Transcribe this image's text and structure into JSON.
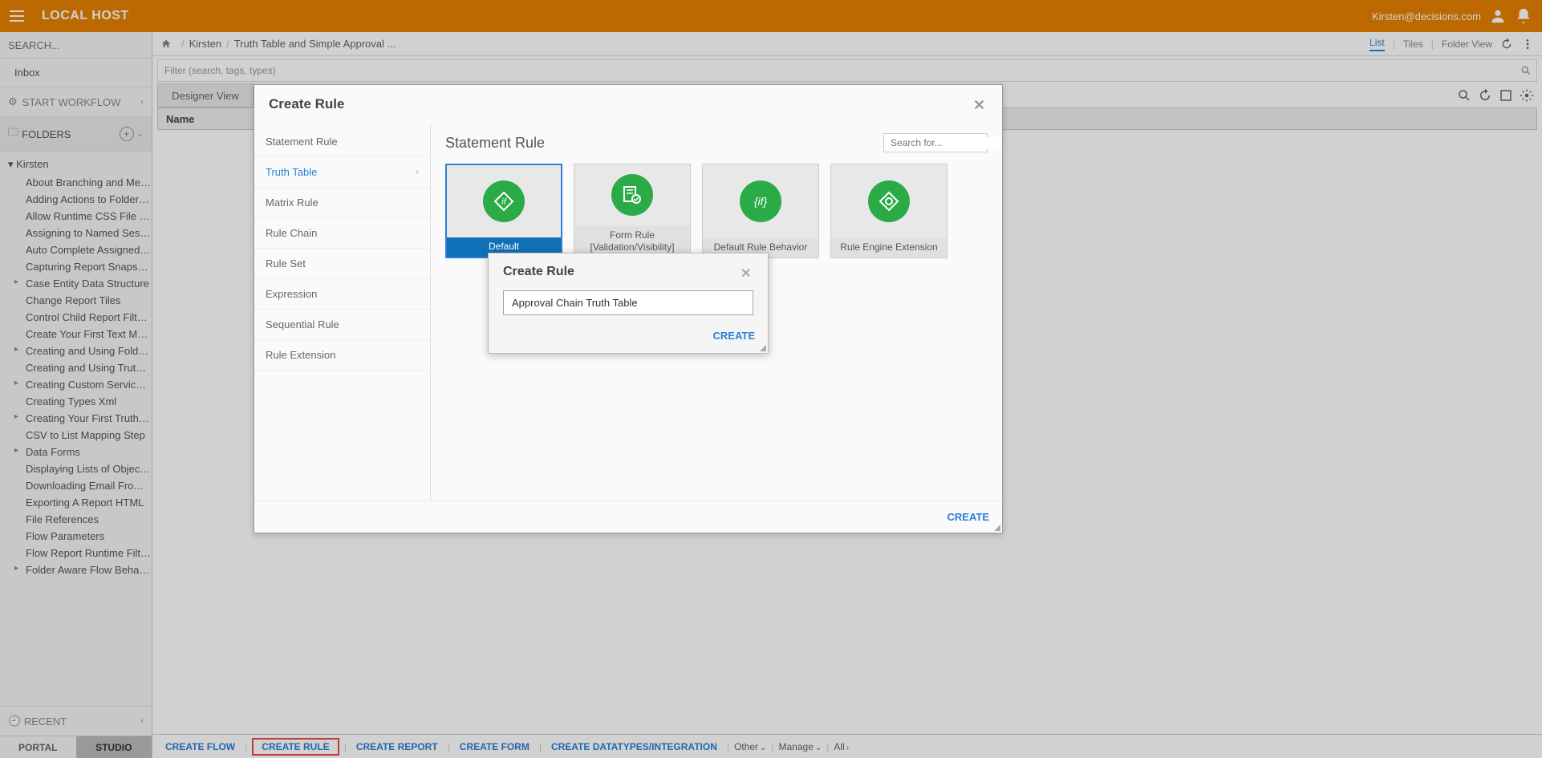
{
  "header": {
    "title": "LOCAL HOST",
    "user_email": "Kirsten@decisions.com"
  },
  "sidebar": {
    "search_placeholder": "SEARCH...",
    "inbox": "Inbox",
    "start_workflow": "START WORKFLOW",
    "folders_label": "FOLDERS",
    "root": "Kirsten",
    "items": [
      "About Branching and Merging Flows",
      "Adding Actions to Folder Extensions",
      "Allow Runtime CSS File Name",
      "Assigning to Named Sessions",
      "Auto Complete Assigned Form",
      "Capturing Report Snapshot",
      "Case Entity Data Structure",
      "Change Report Tiles",
      "Control Child Report Filter Value",
      "Create Your First Text Merge",
      "Creating and Using Folder Extensions",
      "Creating and Using Truth Tables",
      "Creating Custom Service Catalog",
      "Creating Types Xml",
      "Creating Your First Truth Table",
      "CSV to List Mapping Step",
      "Data Forms",
      "Displaying Lists of Objects In A Form",
      "Downloading Email From a Mail",
      "Exporting A Report HTML",
      "File References",
      "Flow Parameters",
      "Flow Report Runtime Filters",
      "Folder Aware Flow Behavior"
    ],
    "arrow_indices": [
      6,
      10,
      12,
      14,
      16,
      23
    ],
    "recent": "RECENT",
    "tabs": {
      "portal": "PORTAL",
      "studio": "STUDIO"
    }
  },
  "breadcrumb": {
    "items": [
      "Kirsten",
      "Truth Table and Simple Approval ..."
    ],
    "views": {
      "list": "List",
      "tiles": "Tiles",
      "folder": "Folder View"
    }
  },
  "filter_placeholder": "Filter (search, tags, types)",
  "designer_view": "Designer View",
  "name_col": "Name",
  "bottom": {
    "create_flow": "CREATE FLOW",
    "create_rule": "CREATE RULE",
    "create_report": "CREATE REPORT",
    "create_form": "CREATE FORM",
    "create_dt": "CREATE DATATYPES/INTEGRATION",
    "other": "Other",
    "manage": "Manage",
    "all": "All"
  },
  "modal": {
    "title": "Create Rule",
    "categories": [
      "Statement Rule",
      "Truth Table",
      "Matrix Rule",
      "Rule Chain",
      "Rule Set",
      "Expression",
      "Sequential Rule",
      "Rule Extension"
    ],
    "active_category_index": 1,
    "main_title": "Statement Rule",
    "search_placeholder": "Search for...",
    "cards": [
      {
        "label": "Default"
      },
      {
        "label": "Form Rule [Validation/Visibility]"
      },
      {
        "label": "Default Rule Behavior"
      },
      {
        "label": "Rule Engine Extension"
      }
    ],
    "create": "CREATE"
  },
  "small_modal": {
    "title": "Create Rule",
    "value": "Approval Chain Truth Table",
    "create": "CREATE"
  }
}
